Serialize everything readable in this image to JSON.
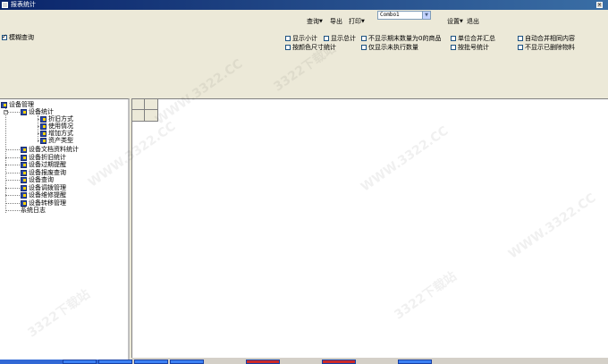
{
  "window": {
    "title": "报表统计"
  },
  "toolbar": {
    "query": "查询",
    "export": "导出",
    "print": "打印",
    "combo_value": "Combo1",
    "settings": "设置",
    "exit": "退出"
  },
  "fuzzy_query": {
    "label": "模糊查询",
    "checked": true
  },
  "options": {
    "show_subtotal": "显示小计",
    "show_total": "显示总计",
    "hide_end_zero": "不显示期末数量为0的商品",
    "unit_merge": "单位合并汇总",
    "auto_merge_same": "自动合并相同内容",
    "by_color_size": "按颜色尺寸统计",
    "only_unexecuted": "仅显示未执行数量",
    "by_batch": "按批号统计",
    "hide_deleted": "不显示已删除物料"
  },
  "tree": {
    "root": "设备管理",
    "stats": "设备统计",
    "depreciation": "折旧方式",
    "usage": "使用情况",
    "increase": "增加方式",
    "asset_type": "资产类型",
    "docs": "设备文档资料统计",
    "depr_stats": "设备折旧统计",
    "expiry": "设备过期提醒",
    "scrap_query": "设备报废查询",
    "query": "设备查询",
    "transfer": "设备调拨管理",
    "repair": "设备维修提醒",
    "relocate": "设备转移管理",
    "log": "系统日志"
  },
  "watermark": "WWW.3322.CC",
  "watermark2": "3322下载站"
}
